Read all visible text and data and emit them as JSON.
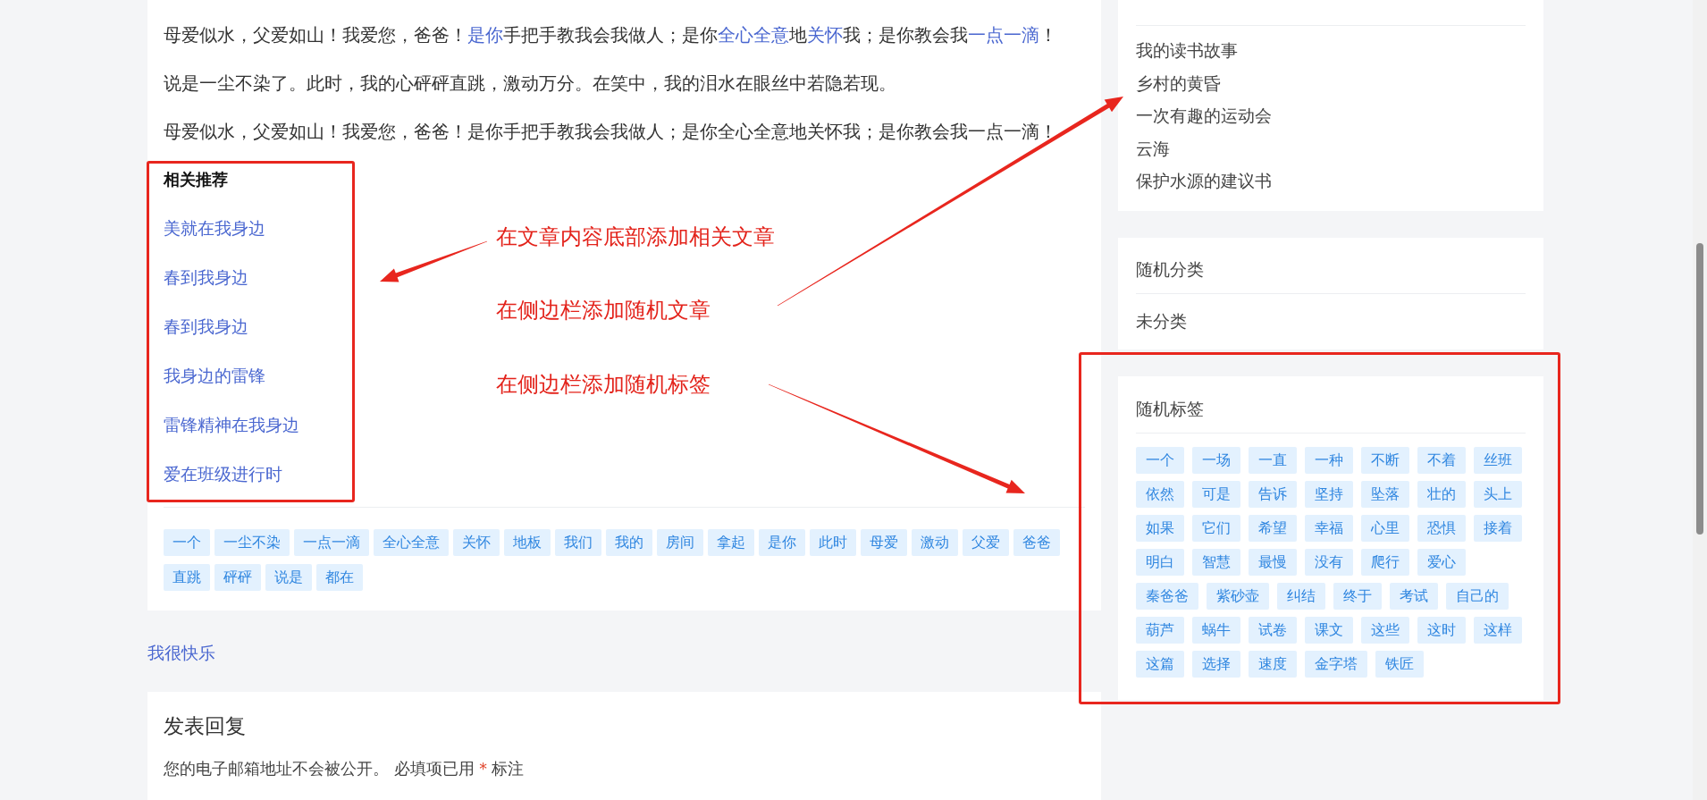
{
  "article": {
    "paragraphs": [
      {
        "segments": [
          {
            "text": "母爱似水，父爱如山！我爱您，爸爸！",
            "link": false
          },
          {
            "text": "是你",
            "link": true
          },
          {
            "text": "手把手教我会我做人；是你",
            "link": false
          },
          {
            "text": "全心全意",
            "link": true
          },
          {
            "text": "地",
            "link": false
          },
          {
            "text": "关怀",
            "link": true
          },
          {
            "text": "我；是你教会我",
            "link": false
          },
          {
            "text": "一点一滴",
            "link": true
          },
          {
            "text": "！",
            "link": false
          }
        ]
      },
      {
        "segments": [
          {
            "text": "说是一尘不染了。此时，我的心砰砰直跳，激动万分。在笑中，我的泪水在眼丝中若隐若现。",
            "link": false
          }
        ]
      },
      {
        "segments": [
          {
            "text": "母爱似水，父爱如山！我爱您，爸爸！是你手把手教我会我做人；是你全心全意地关怀我；是你教会我一点一滴！",
            "link": false
          }
        ]
      }
    ],
    "related": {
      "title": "相关推荐",
      "items": [
        "美就在我身边",
        "春到我身边",
        "春到我身边",
        "我身边的雷锋",
        "雷锋精神在我身边",
        "爱在班级进行时"
      ]
    },
    "tags": [
      "一个",
      "一尘不染",
      "一点一滴",
      "全心全意",
      "关怀",
      "地板",
      "我们",
      "我的",
      "房间",
      "拿起",
      "是你",
      "此时",
      "母爱",
      "激动",
      "父爱",
      "爸爸",
      "直跳",
      "砰砰",
      "说是",
      "都在"
    ]
  },
  "category_link": "我很快乐",
  "reply": {
    "title": "发表回复",
    "note_before": "您的电子邮箱地址不会被公开。 必填项已用 ",
    "note_mark": "*",
    "note_after": " 标注"
  },
  "sidebar": {
    "random_posts": [
      "我的读书故事",
      "乡村的黄昏",
      "一次有趣的运动会",
      "云海",
      "保护水源的建议书"
    ],
    "random_categories": {
      "title": "随机分类",
      "items": [
        "未分类"
      ]
    },
    "random_tags": {
      "title": "随机标签",
      "tags": [
        "一个",
        "一场",
        "一直",
        "一种",
        "不断",
        "不着",
        "丝班",
        "依然",
        "可是",
        "告诉",
        "坚持",
        "坠落",
        "壮的",
        "头上",
        "如果",
        "它们",
        "希望",
        "幸福",
        "心里",
        "恐惧",
        "接着",
        "明白",
        "智慧",
        "最慢",
        "没有",
        "爬行",
        "爱心",
        "秦爸爸",
        "紫砂壶",
        "纠结",
        "终于",
        "考试",
        "自己的",
        "葫芦",
        "蜗牛",
        "试卷",
        "课文",
        "这些",
        "这时",
        "这样",
        "这篇",
        "选择",
        "速度",
        "金字塔",
        "铁匠"
      ]
    }
  },
  "annotations": [
    "在文章内容底部添加相关文章",
    "在侧边栏添加随机文章",
    "在侧边栏添加随机标签"
  ]
}
